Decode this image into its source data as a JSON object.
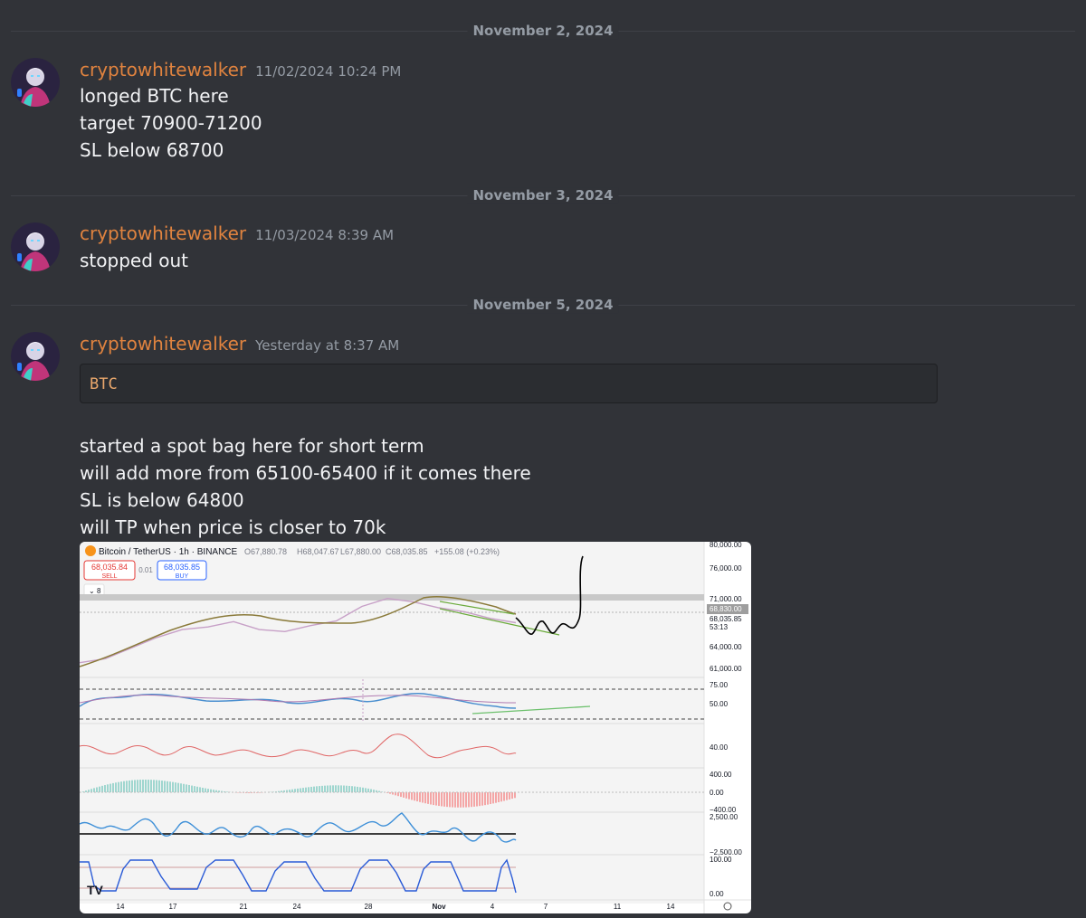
{
  "dividers": [
    "November 2, 2024",
    "November 3, 2024",
    "November 5, 2024"
  ],
  "messages": [
    {
      "username": "cryptowhitewalker",
      "timestamp": "11/02/2024 10:24 PM",
      "lines": [
        "longed BTC here",
        "target 70900-71200",
        "SL below 68700"
      ]
    },
    {
      "username": "cryptowhitewalker",
      "timestamp": "11/03/2024 8:39 AM",
      "lines": [
        "stopped out"
      ]
    },
    {
      "username": "cryptowhitewalker",
      "timestamp": "Yesterday at 8:37 AM",
      "code": "BTC",
      "lines": [
        "started a spot bag here for short term",
        "will add more from 65100-65400 if it comes there",
        "SL is below 64800",
        "will TP when price is closer to 70k"
      ]
    }
  ],
  "colors": {
    "background": "#313338",
    "username": "#e0833f",
    "timestamp": "#949ba4",
    "text": "#f2f3f5",
    "code": "#e9a76c",
    "sell": "#e53935",
    "buy": "#2962ff"
  },
  "icons": [
    "avatar-icon",
    "tradingview-logo-icon",
    "settings-icon"
  ],
  "chart": {
    "symbol": "Bitcoin / TetherUS · 1h · BINANCE",
    "ohlc": {
      "o": "O67,880.78",
      "h": "H68,047.67",
      "l": "L67,880.00",
      "c": "C68,035.85",
      "chg": "+155.08 (+0.23%)"
    },
    "sell_price": "68,035.84",
    "sell_label": "SELL",
    "spread": "0.01",
    "buy_price": "68,035.85",
    "buy_label": "BUY",
    "indicator_count": "8",
    "price_ticks": [
      "80,000.00",
      "76,000.00",
      "71,000.00",
      "68,830.00",
      "68,035.85",
      "53:13",
      "64,000.00",
      "61,000.00"
    ],
    "pane_ticks": [
      "75.00",
      "50.00",
      "40.00",
      "400.00",
      "0.00",
      "−400.00",
      "2,500.00",
      "−2,500.00",
      "100.00",
      "0.00"
    ],
    "x_ticks": [
      "14",
      "17",
      "21",
      "24",
      "28",
      "Nov",
      "4",
      "7",
      "11",
      "14"
    ]
  },
  "chart_data": {
    "type": "line",
    "series": [
      {
        "values": [
          62000,
          62600,
          64200,
          65800,
          67000,
          67400,
          68200,
          67000,
          66700,
          67600,
          68300,
          70500,
          71700,
          71200,
          70300,
          69700,
          68700,
          68035
        ]
      }
    ],
    "ylim": [
      61000,
      80000
    ]
  }
}
